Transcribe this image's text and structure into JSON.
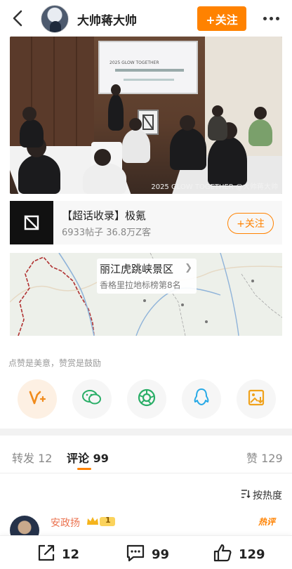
{
  "header": {
    "user_name": "大帅蒋大帅",
    "follow_label": "+关注"
  },
  "photo": {
    "watermark": "2025 GLOW TOGETHER @大帅蒋大帅",
    "screen_text": "2025 GLOW TOGETHER"
  },
  "topic": {
    "title": "【超话收录】极氪",
    "stats": "6933帖子 36.8万Z客",
    "follow_label": "+关注"
  },
  "location": {
    "name": "丽江虎跳峡景区",
    "subtitle": "香格里拉地标榜第8名"
  },
  "reward": {
    "prompt": "点赞是美意，赞赏是鼓励",
    "buttons": [
      "vplus-icon",
      "wechat-icon",
      "moments-icon",
      "qq-icon",
      "save-image-icon"
    ]
  },
  "tabs": [
    {
      "label": "转发",
      "count": "12"
    },
    {
      "label": "评论",
      "count": "99"
    },
    {
      "label": "赞",
      "count": "129"
    }
  ],
  "sort": {
    "label": "按热度"
  },
  "comment": {
    "user_name": "安政扬",
    "badge_level": "1",
    "hot_tag": "热评"
  },
  "bottom_bar": {
    "repost_count": "12",
    "comment_count": "99",
    "like_count": "129"
  },
  "colors": {
    "accent": "#ff8200",
    "comment_name": "#eb7350"
  }
}
